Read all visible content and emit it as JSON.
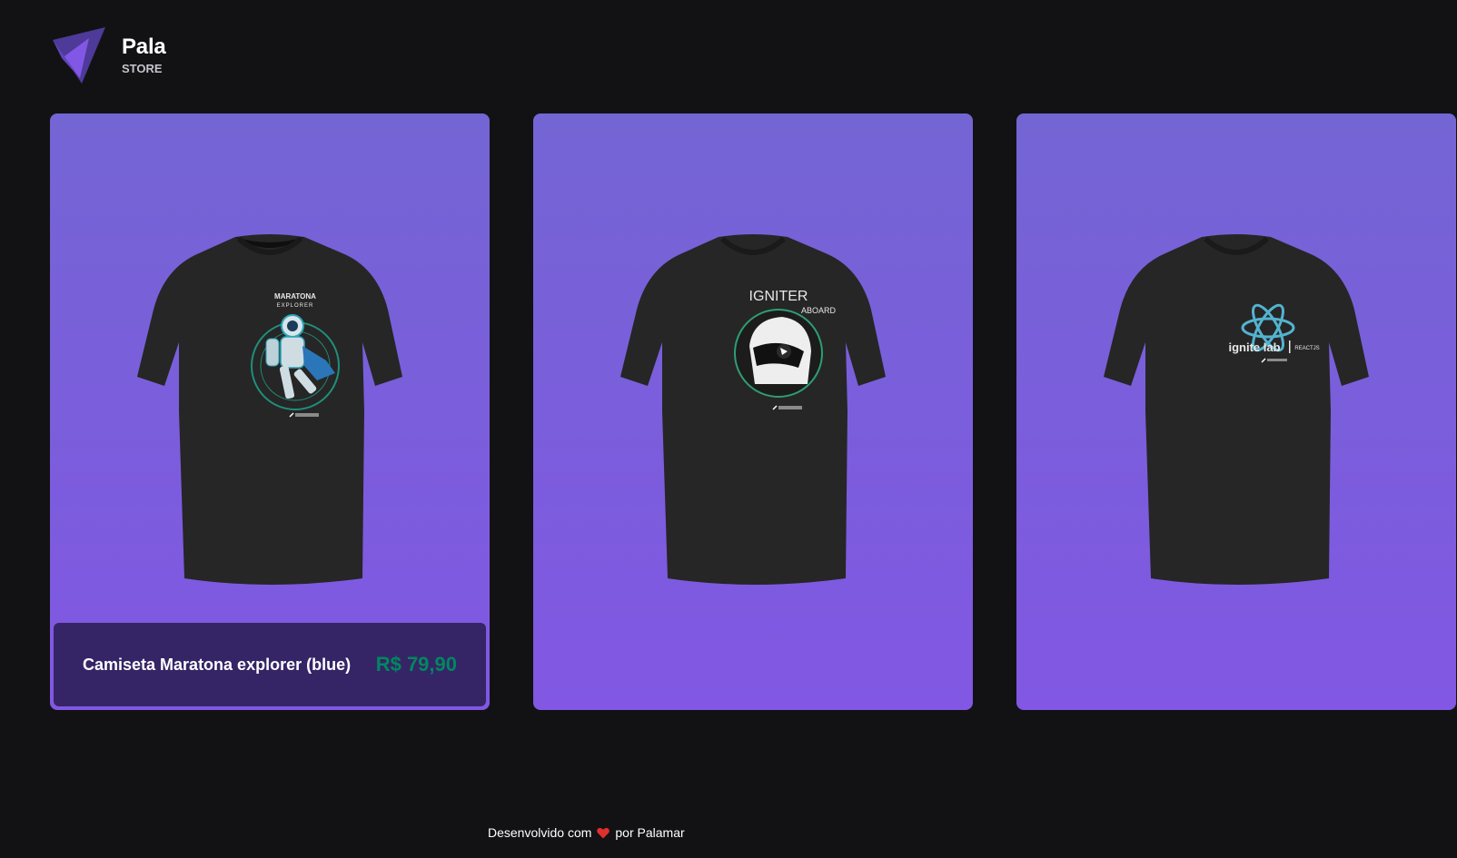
{
  "brand": {
    "name": "Pala",
    "sub": "STORE",
    "logo_icon": "purple-triangle-logo-icon"
  },
  "products": [
    {
      "name": "Camiseta Maratona explorer (blue)",
      "price": "R$ 79,90",
      "print": "maratona-explorer-astronaut",
      "print_text": [
        "MARATONA",
        "EXPLORER"
      ]
    },
    {
      "name": "",
      "price": "",
      "print": "igniter-aboard-helmet",
      "print_text": [
        "IGNITER",
        "ABOARD"
      ]
    },
    {
      "name": "",
      "price": "",
      "print": "ignite-lab-reactjs",
      "print_text": [
        "ignite lab",
        "REACTJS"
      ]
    }
  ],
  "footer": {
    "prefix": "Desenvolvido com",
    "heart_icon": "heart-icon",
    "suffix": "por Palamar"
  },
  "colors": {
    "background": "#121214",
    "card_top": "#7465d4",
    "card_bottom": "#8157e3",
    "price": "#00875f",
    "heart": "#e02f2f"
  }
}
